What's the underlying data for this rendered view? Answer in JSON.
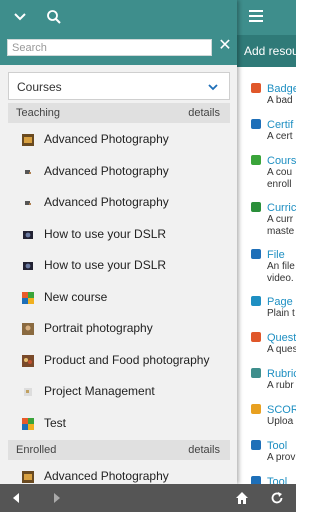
{
  "drawer": {
    "search": {
      "placeholder": "Search",
      "value": ""
    },
    "courses_select": {
      "selected": "Courses"
    },
    "teaching": {
      "title": "Teaching",
      "details_label": "details",
      "courses": [
        {
          "name": "Advanced Photography",
          "icon": "photo-thumb-icon"
        },
        {
          "name": "Advanced Photography",
          "icon": "small-thumb-icon"
        },
        {
          "name": "Advanced Photography",
          "icon": "small-thumb-icon"
        },
        {
          "name": "How to use your DSLR",
          "icon": "camera-thumb-icon"
        },
        {
          "name": "How to use your DSLR",
          "icon": "camera-thumb-icon"
        },
        {
          "name": "New course",
          "icon": "colored-squares-icon"
        },
        {
          "name": "Portrait photography",
          "icon": "portrait-thumb-icon"
        },
        {
          "name": "Product and Food photography",
          "icon": "food-thumb-icon"
        },
        {
          "name": "Project Management",
          "icon": "pm-thumb-icon"
        },
        {
          "name": "Test",
          "icon": "colored-squares-icon"
        }
      ]
    },
    "enrolled": {
      "title": "Enrolled",
      "details_label": "details",
      "courses": [
        {
          "name": "Advanced Photography",
          "icon": "photo-thumb-icon"
        }
      ]
    }
  },
  "right_panel": {
    "subheader": "Add resou",
    "resources": [
      {
        "name": "Badge",
        "desc": "A bad",
        "desc2": "",
        "icon": "badge-icon",
        "color": "#e0572a"
      },
      {
        "name": "Certif",
        "desc": "A cert",
        "desc2": "",
        "icon": "certificate-icon",
        "color": "#1e6fb8"
      },
      {
        "name": "Cours",
        "desc": "A cou",
        "desc2": "enroll",
        "icon": "puzzle-icon",
        "color": "#3aa43a"
      },
      {
        "name": "Curric",
        "desc": "A curr",
        "desc2": "maste",
        "icon": "bar-chart-icon",
        "color": "#2a8f3a"
      },
      {
        "name": "File",
        "desc": "An file",
        "desc2": "video.",
        "icon": "file-icon",
        "color": "#1e6fb8"
      },
      {
        "name": "Page",
        "desc": "Plain t",
        "desc2": "",
        "icon": "page-icon",
        "color": "#1e8fc2"
      },
      {
        "name": "Quest",
        "desc": "A ques",
        "desc2": "",
        "icon": "list-icon",
        "color": "#e0572a"
      },
      {
        "name": "Rubric",
        "desc": "A rubr",
        "desc2": "",
        "icon": "rubric-icon",
        "color": "#3e8e8c"
      },
      {
        "name": "SCOR",
        "desc": "Uploa",
        "desc2": "",
        "icon": "scorm-icon",
        "color": "#e8a020"
      },
      {
        "name": "Tool",
        "desc": "A prov",
        "desc2": "",
        "icon": "wrench-icon",
        "color": "#1e6fb8"
      },
      {
        "name": "Tool",
        "desc": "",
        "desc2": "",
        "icon": "tool-icon",
        "color": "#1e6fb8"
      }
    ]
  },
  "colors": {
    "teal": "#3e8e8c",
    "teal_dark": "#2f7a78",
    "link": "#1e8fc2"
  }
}
